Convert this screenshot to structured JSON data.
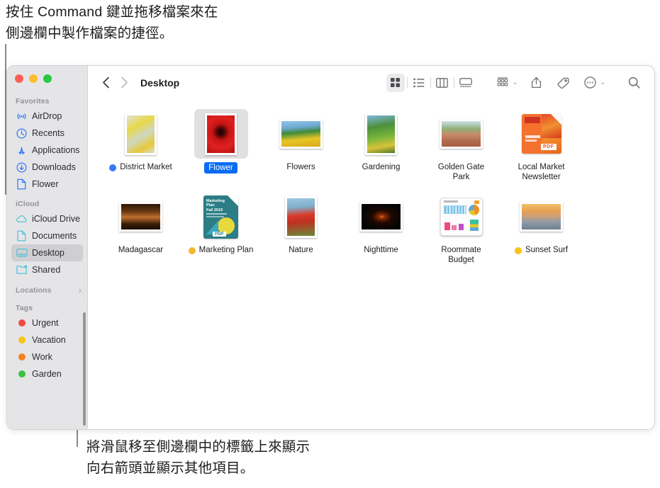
{
  "annotations": {
    "top": "按住 Command 鍵並拖移檔案來在\n側邊欄中製作檔案的捷徑。",
    "bottom": "將滑鼠移至側邊欄中的標籤上來顯示\n向右箭頭並顯示其他項目。"
  },
  "window": {
    "traffic_lights": [
      {
        "name": "close",
        "color": "#ff5f57"
      },
      {
        "name": "minimize",
        "color": "#febc2e"
      },
      {
        "name": "zoom",
        "color": "#28c840"
      }
    ]
  },
  "toolbar": {
    "back_label": "‹",
    "forward_label": "›",
    "breadcrumb": "Desktop",
    "view_buttons": [
      {
        "name": "icon-view",
        "title": "as Icons",
        "active": true
      },
      {
        "name": "list-view",
        "title": "as List",
        "active": false
      },
      {
        "name": "column-view",
        "title": "as Columns",
        "active": false
      },
      {
        "name": "gallery-view",
        "title": "as Gallery",
        "active": false
      }
    ],
    "group_by_label": "Group",
    "share_label": "Share",
    "tags_label": "Tags",
    "more_label": "More",
    "search_label": "Search",
    "chevron": "⌄"
  },
  "sidebar": {
    "sections": [
      {
        "name": "favorites",
        "header": "Favorites",
        "chevron": "",
        "items": [
          {
            "label": "AirDrop",
            "icon": "airdrop-icon",
            "color": "#3478f6",
            "selected": false
          },
          {
            "label": "Recents",
            "icon": "clock-icon",
            "color": "#3478f6",
            "selected": false
          },
          {
            "label": "Applications",
            "icon": "applications-icon",
            "color": "#3478f6",
            "selected": false
          },
          {
            "label": "Downloads",
            "icon": "download-icon",
            "color": "#3478f6",
            "selected": false
          },
          {
            "label": "Flower",
            "icon": "document-icon",
            "color": "#3478f6",
            "selected": false
          }
        ]
      },
      {
        "name": "icloud",
        "header": "iCloud",
        "chevron": "",
        "items": [
          {
            "label": "iCloud Drive",
            "icon": "cloud-icon",
            "color": "#4fc3d9",
            "selected": false
          },
          {
            "label": "Documents",
            "icon": "document-icon",
            "color": "#4fc3d9",
            "selected": false
          },
          {
            "label": "Desktop",
            "icon": "desktop-icon",
            "color": "#4fc3d9",
            "selected": true
          },
          {
            "label": "Shared",
            "icon": "shared-folder-icon",
            "color": "#4fc3d9",
            "selected": false
          }
        ]
      },
      {
        "name": "locations",
        "header": "Locations",
        "chevron": "›",
        "items": []
      },
      {
        "name": "tags",
        "header": "Tags",
        "chevron": "",
        "items": [
          {
            "label": "Urgent",
            "icon": "tag-dot",
            "color": "#ee4b45",
            "selected": false
          },
          {
            "label": "Vacation",
            "icon": "tag-dot",
            "color": "#f5c518",
            "selected": false
          },
          {
            "label": "Work",
            "icon": "tag-dot",
            "color": "#f58220",
            "selected": false
          },
          {
            "label": "Garden",
            "icon": "tag-dot",
            "color": "#3ec13e",
            "selected": false
          }
        ]
      }
    ]
  },
  "files": [
    {
      "label": "District Market",
      "kind": "photo-portrait",
      "tag": "#3478f6",
      "selected": false
    },
    {
      "label": "Flower",
      "kind": "photo-portrait",
      "tag": "",
      "selected": true
    },
    {
      "label": "Flowers",
      "kind": "photo-landscape",
      "tag": "",
      "selected": false
    },
    {
      "label": "Gardening",
      "kind": "photo-portrait",
      "tag": "",
      "selected": false
    },
    {
      "label": "Golden Gate Park",
      "kind": "photo-landscape",
      "tag": "",
      "selected": false
    },
    {
      "label": "Local Market Newsletter",
      "kind": "pdf-orange",
      "tag": "",
      "selected": false
    },
    {
      "label": "Madagascar",
      "kind": "photo-landscape",
      "tag": "",
      "selected": false
    },
    {
      "label": "Marketing Plan",
      "kind": "pdf-teal",
      "tag": "#f5b731",
      "selected": false
    },
    {
      "label": "Nature",
      "kind": "photo-portrait",
      "tag": "",
      "selected": false
    },
    {
      "label": "Nighttime",
      "kind": "photo-landscape",
      "tag": "",
      "selected": false
    },
    {
      "label": "Roommate Budget",
      "kind": "spreadsheet",
      "tag": "",
      "selected": false
    },
    {
      "label": "Sunset Surf",
      "kind": "photo-landscape",
      "tag": "#f5c518",
      "selected": false
    }
  ]
}
